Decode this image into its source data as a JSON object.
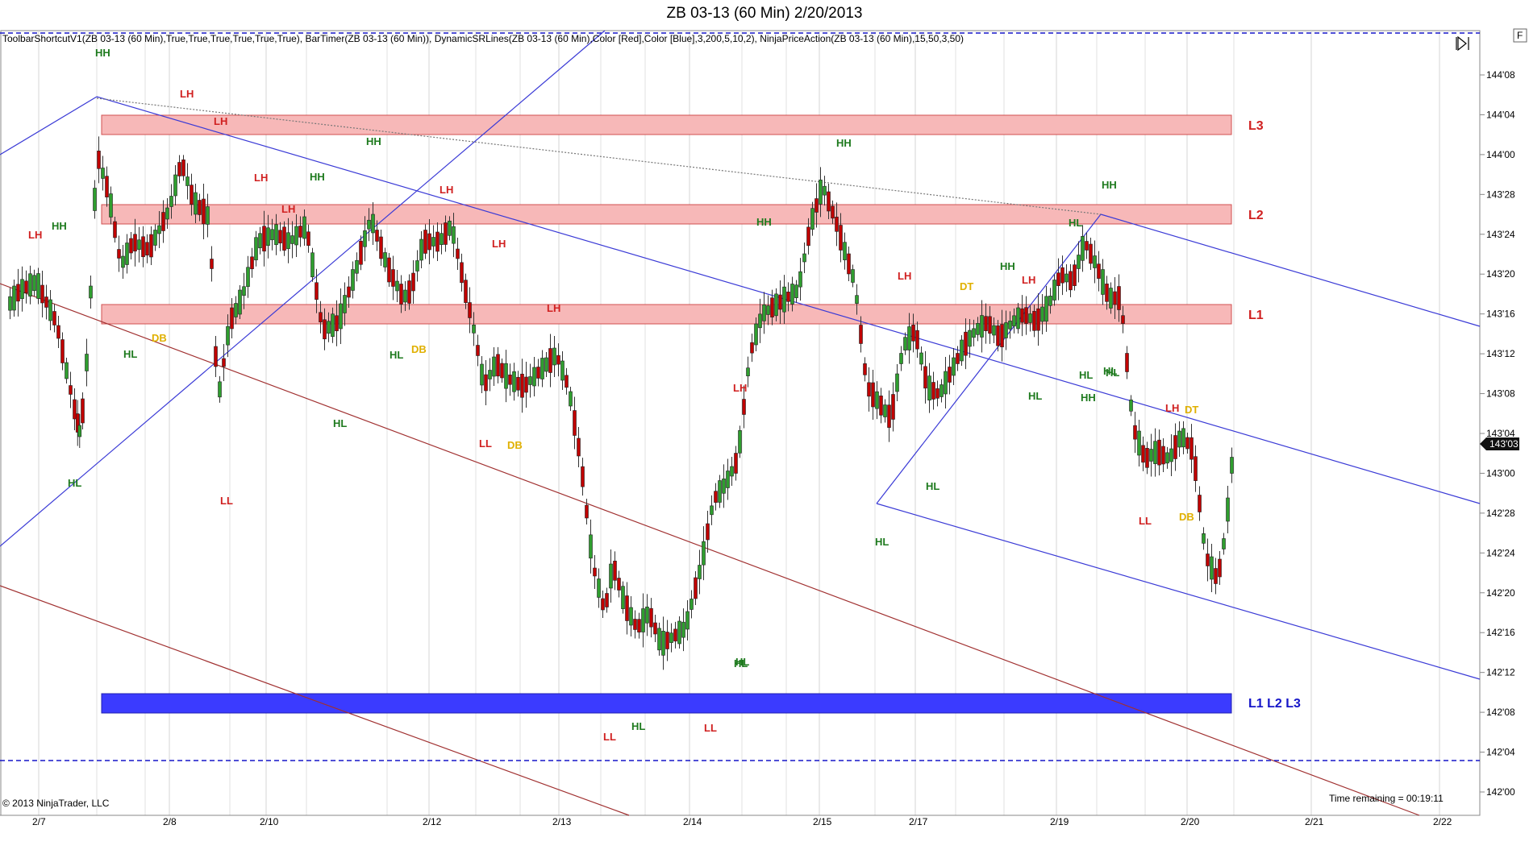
{
  "title": "ZB 03-13 (60 Min)  2/20/2013",
  "indicators_text": "ToolbarShortcutV1(ZB  03-13  (60  Min),True,True,True,True,True,True),  BarTimer(ZB  03-13  (60  Min)),  DynamicSRLines(ZB  03-13  (60  Min),Color  [Red],Color  [Blue],3,200,5,10,2),  NinjaPriceAction(ZB  03-13  (60  Min),15,50,3,50)",
  "copyright": "© 2013 NinjaTrader, LLC",
  "time_remaining": "Time remaining = 00:19:11",
  "corner_button": "F",
  "current_price_label": "143'03",
  "colors": {
    "up_candle": "#2f9e2f",
    "down_candle": "#c00000",
    "resistance_zone": "#f7b8b8",
    "support_zone": "#3b3bff",
    "channel_blue": "#3a3ad6",
    "channel_red": "#a03030",
    "label_red": "#d02020",
    "label_green": "#1e7a1e",
    "label_gold": "#e0b000",
    "level_red": "#d02020",
    "level_blue": "#1515c8"
  },
  "chart_data": {
    "type": "candlestick",
    "price_unit": "32nds",
    "ylim": [
      140.0,
      144.5
    ],
    "y_ticks": [
      "144'08",
      "144'04",
      "144'00",
      "143'28",
      "143'24",
      "143'20",
      "143'16",
      "143'12",
      "143'08",
      "143'04",
      "143'00",
      "142'28",
      "142'24",
      "142'20",
      "142'16",
      "142'12",
      "142'08",
      "142'04",
      "142'00"
    ],
    "x_ticks": [
      "2/7",
      "2/8",
      "2/10",
      "2/12",
      "2/13",
      "2/14",
      "2/15",
      "2/17",
      "2/19",
      "2/20",
      "2/21",
      "2/22"
    ],
    "zones": [
      {
        "name": "L3",
        "low": "144'02",
        "high": "144'04",
        "color": "red"
      },
      {
        "name": "L2",
        "low": "143'25",
        "high": "143'27",
        "color": "red"
      },
      {
        "name": "L1",
        "low": "143'15",
        "high": "143'17",
        "color": "red"
      },
      {
        "name": "L1 L2 L3",
        "low": "142'08",
        "high": "142'10",
        "color": "blue"
      }
    ],
    "annotations": [
      {
        "text": "HH",
        "color": "green"
      },
      {
        "text": "LH",
        "color": "red"
      },
      {
        "text": "LH",
        "color": "red"
      },
      {
        "text": "LH",
        "color": "red"
      },
      {
        "text": "HH",
        "color": "green"
      },
      {
        "text": "LH",
        "color": "red"
      },
      {
        "text": "HH",
        "color": "green"
      },
      {
        "text": "LH",
        "color": "red"
      },
      {
        "text": "HH",
        "color": "green"
      },
      {
        "text": "LH",
        "color": "red"
      },
      {
        "text": "LH",
        "color": "red"
      },
      {
        "text": "DB",
        "color": "gold"
      },
      {
        "text": "HL",
        "color": "green"
      },
      {
        "text": "LH",
        "color": "red"
      },
      {
        "text": "HL",
        "color": "green"
      },
      {
        "text": "DB",
        "color": "gold"
      },
      {
        "text": "HL",
        "color": "green"
      },
      {
        "text": "LL",
        "color": "red"
      },
      {
        "text": "HL",
        "color": "green"
      },
      {
        "text": "LL",
        "color": "red"
      },
      {
        "text": "DB",
        "color": "gold"
      },
      {
        "text": "LH",
        "color": "red"
      },
      {
        "text": "HL",
        "color": "green"
      },
      {
        "text": "HL",
        "color": "green"
      },
      {
        "text": "LL",
        "color": "red"
      },
      {
        "text": "HL",
        "color": "green"
      },
      {
        "text": "LL",
        "color": "red"
      },
      {
        "text": "HH",
        "color": "green"
      },
      {
        "text": "HH",
        "color": "green"
      },
      {
        "text": "LH",
        "color": "red"
      },
      {
        "text": "HL",
        "color": "green"
      },
      {
        "text": "HL",
        "color": "green"
      },
      {
        "text": "DT",
        "color": "gold"
      },
      {
        "text": "HH",
        "color": "green"
      },
      {
        "text": "LH",
        "color": "red"
      },
      {
        "text": "HL",
        "color": "green"
      },
      {
        "text": "HH",
        "color": "green"
      },
      {
        "text": "HH",
        "color": "green"
      },
      {
        "text": "HL",
        "color": "green"
      },
      {
        "text": "HL",
        "color": "green"
      },
      {
        "text": "HL",
        "color": "green"
      },
      {
        "text": "LH",
        "color": "red"
      },
      {
        "text": "DT",
        "color": "gold"
      },
      {
        "text": "LL",
        "color": "red"
      },
      {
        "text": "DB",
        "color": "gold"
      },
      {
        "text": "HL",
        "color": "green"
      }
    ],
    "level_labels": [
      "L3",
      "L2",
      "L1",
      "L1 L2 L3"
    ]
  }
}
